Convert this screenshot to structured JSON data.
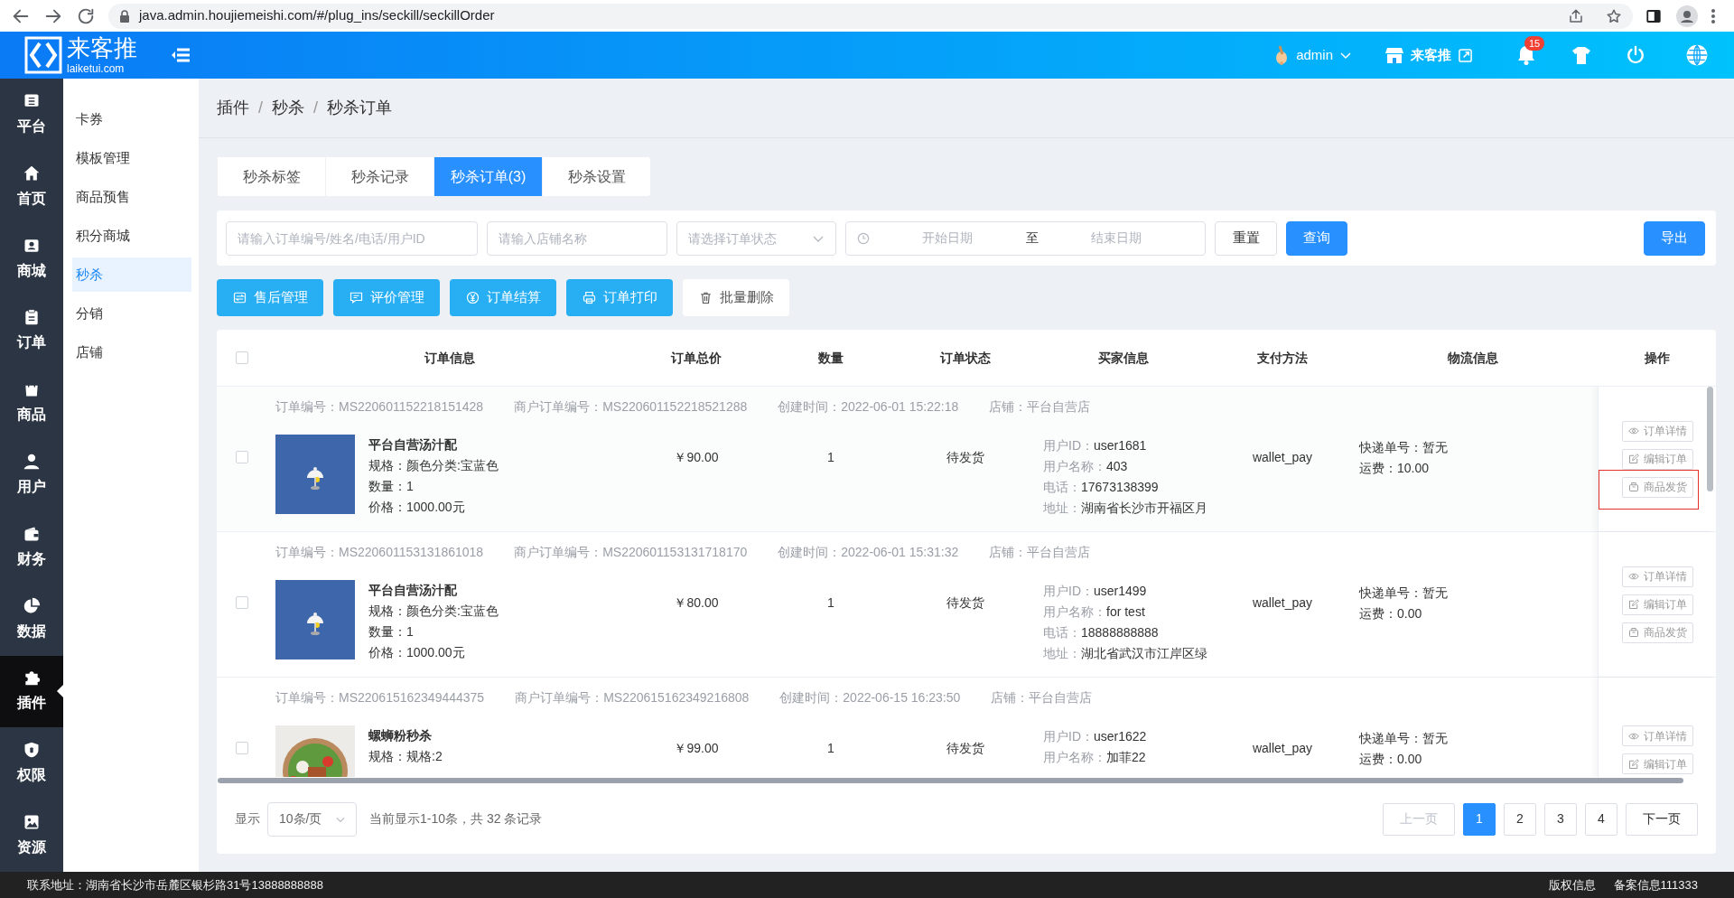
{
  "browser": {
    "url": "java.admin.houjiemeishi.com/#/plug_ins/seckill/seckillOrder"
  },
  "header": {
    "logo_text": "来客推",
    "logo_domain": "laiketui.com",
    "user": "admin",
    "store_link": "来客推",
    "notification_count": "15"
  },
  "sidebar": {
    "items": [
      {
        "label": "平台",
        "selected": false
      },
      {
        "label": "首页",
        "selected": false
      },
      {
        "label": "商城",
        "selected": false
      },
      {
        "label": "订单",
        "selected": false
      },
      {
        "label": "商品",
        "selected": false
      },
      {
        "label": "用户",
        "selected": false
      },
      {
        "label": "财务",
        "selected": false
      },
      {
        "label": "数据",
        "selected": false
      },
      {
        "label": "插件",
        "selected": true
      },
      {
        "label": "权限",
        "selected": false
      },
      {
        "label": "资源",
        "selected": false
      }
    ]
  },
  "subnav": {
    "items": [
      {
        "label": "卡券",
        "selected": false
      },
      {
        "label": "模板管理",
        "selected": false
      },
      {
        "label": "商品预售",
        "selected": false
      },
      {
        "label": "积分商城",
        "selected": false
      },
      {
        "label": "秒杀",
        "selected": true
      },
      {
        "label": "分销",
        "selected": false
      },
      {
        "label": "店铺",
        "selected": false
      }
    ]
  },
  "breadcrumb": {
    "separator": "/",
    "items": [
      "插件",
      "秒杀",
      "秒杀订单"
    ]
  },
  "tabs": [
    {
      "label": "秒杀标签",
      "selected": false
    },
    {
      "label": "秒杀记录",
      "selected": false
    },
    {
      "label": "秒杀订单(3)",
      "selected": true
    },
    {
      "label": "秒杀设置",
      "selected": false
    }
  ],
  "filters": {
    "keyword": {
      "placeholder": "请输入订单编号/姓名/电话/用户ID"
    },
    "store": {
      "placeholder": "请输入店铺名称"
    },
    "status": {
      "placeholder": "请选择订单状态"
    },
    "date_start": {
      "placeholder": "开始日期"
    },
    "date_separator": "至",
    "date_end": {
      "placeholder": "结束日期"
    },
    "reset": "重置",
    "search": "查询",
    "export": "导出"
  },
  "actions": [
    {
      "label": "售后管理",
      "kind": "primary"
    },
    {
      "label": "评价管理",
      "kind": "primary"
    },
    {
      "label": "订单结算",
      "kind": "primary"
    },
    {
      "label": "订单打印",
      "kind": "primary"
    },
    {
      "label": "批量删除",
      "kind": "plain"
    }
  ],
  "table": {
    "select_all_checked": false,
    "columns": [
      "订单信息",
      "订单总价",
      "数量",
      "订单状态",
      "买家信息",
      "支付方法",
      "物流信息",
      "操作"
    ],
    "rows": [
      {
        "checked": false,
        "meta": [
          "订单编号：MS220601152218151428",
          "商户订单编号：MS220601152218521288",
          "创建时间：2022-06-01 15:22:18",
          "店铺：平台自营店"
        ],
        "image": {
          "kind": "picture"
        },
        "product": [
          "平台自营汤汁配",
          "规格：颜色分类:宝蓝色",
          "数量：1",
          "价格：1000.00元"
        ],
        "total": "￥90.00",
        "count": "1",
        "status": "待发货",
        "buyer": [
          {
            "label": "用户ID：",
            "value": "user1681"
          },
          {
            "label": "用户名称：",
            "value": "403"
          },
          {
            "label": "电话：",
            "value": "17673138399"
          },
          {
            "label": "地址：",
            "value": "湖南省长沙市开福区月"
          }
        ],
        "payment": "wallet_pay",
        "logistics": [
          "快递单号：暂无",
          "运费：10.00"
        ],
        "operations": [
          {
            "label": "订单详情",
            "highlighted": false
          },
          {
            "label": "编辑订单",
            "highlighted": false
          },
          {
            "label": "商品发货",
            "highlighted": true
          }
        ]
      },
      {
        "checked": false,
        "meta": [
          "订单编号：MS220601153131861018",
          "商户订单编号：MS220601153131718170",
          "创建时间：2022-06-01 15:31:32",
          "店铺：平台自营店"
        ],
        "image": {
          "kind": "picture"
        },
        "product": [
          "平台自营汤汁配",
          "规格：颜色分类:宝蓝色",
          "数量：1",
          "价格：1000.00元"
        ],
        "total": "￥80.00",
        "count": "1",
        "status": "待发货",
        "buyer": [
          {
            "label": "用户ID：",
            "value": "user1499"
          },
          {
            "label": "用户名称：",
            "value": "for test"
          },
          {
            "label": "电话：",
            "value": "18888888888"
          },
          {
            "label": "地址：",
            "value": "湖北省武汉市江岸区绿"
          }
        ],
        "payment": "wallet_pay",
        "logistics": [
          "快递单号：暂无",
          "运费：0.00"
        ],
        "operations": [
          {
            "label": "订单详情",
            "highlighted": false
          },
          {
            "label": "编辑订单",
            "highlighted": false
          },
          {
            "label": "商品发货",
            "highlighted": false
          }
        ]
      },
      {
        "checked": false,
        "meta": [
          "订单编号：MS220615162349444375",
          "商户订单编号：MS220615162349216808",
          "创建时间：2022-06-15 16:23:50",
          "店铺：平台自营店"
        ],
        "image": {
          "kind": "picture"
        },
        "product": [
          "螺蛳粉秒杀",
          "规格：规格:2"
        ],
        "total": "￥99.00",
        "count": "1",
        "status": "待发货",
        "buyer": [
          {
            "label": "用户ID：",
            "value": "user1622"
          },
          {
            "label": "用户名称：",
            "value": "加菲22"
          }
        ],
        "payment": "wallet_pay",
        "logistics": [
          "快递单号：暂无",
          "运费：0.00"
        ],
        "operations": [
          {
            "label": "订单详情",
            "highlighted": false
          },
          {
            "label": "编辑订单",
            "highlighted": false
          }
        ]
      }
    ]
  },
  "pagination": {
    "page_size_label": "显示",
    "page_size": "10条/页",
    "summary": "当前显示1-10条，共 32 条记录",
    "prev": {
      "label": "上一页",
      "disabled": true
    },
    "pages": [
      {
        "label": "1",
        "selected": true
      },
      {
        "label": "2",
        "selected": false
      },
      {
        "label": "3",
        "selected": false
      },
      {
        "label": "4",
        "selected": false
      }
    ],
    "next": {
      "label": "下一页",
      "disabled": false
    }
  },
  "footer": {
    "address": "联系地址：湖南省长沙市岳麓区银杉路31号13888888888",
    "links": [
      "版权信息",
      "备案信息111333"
    ]
  }
}
